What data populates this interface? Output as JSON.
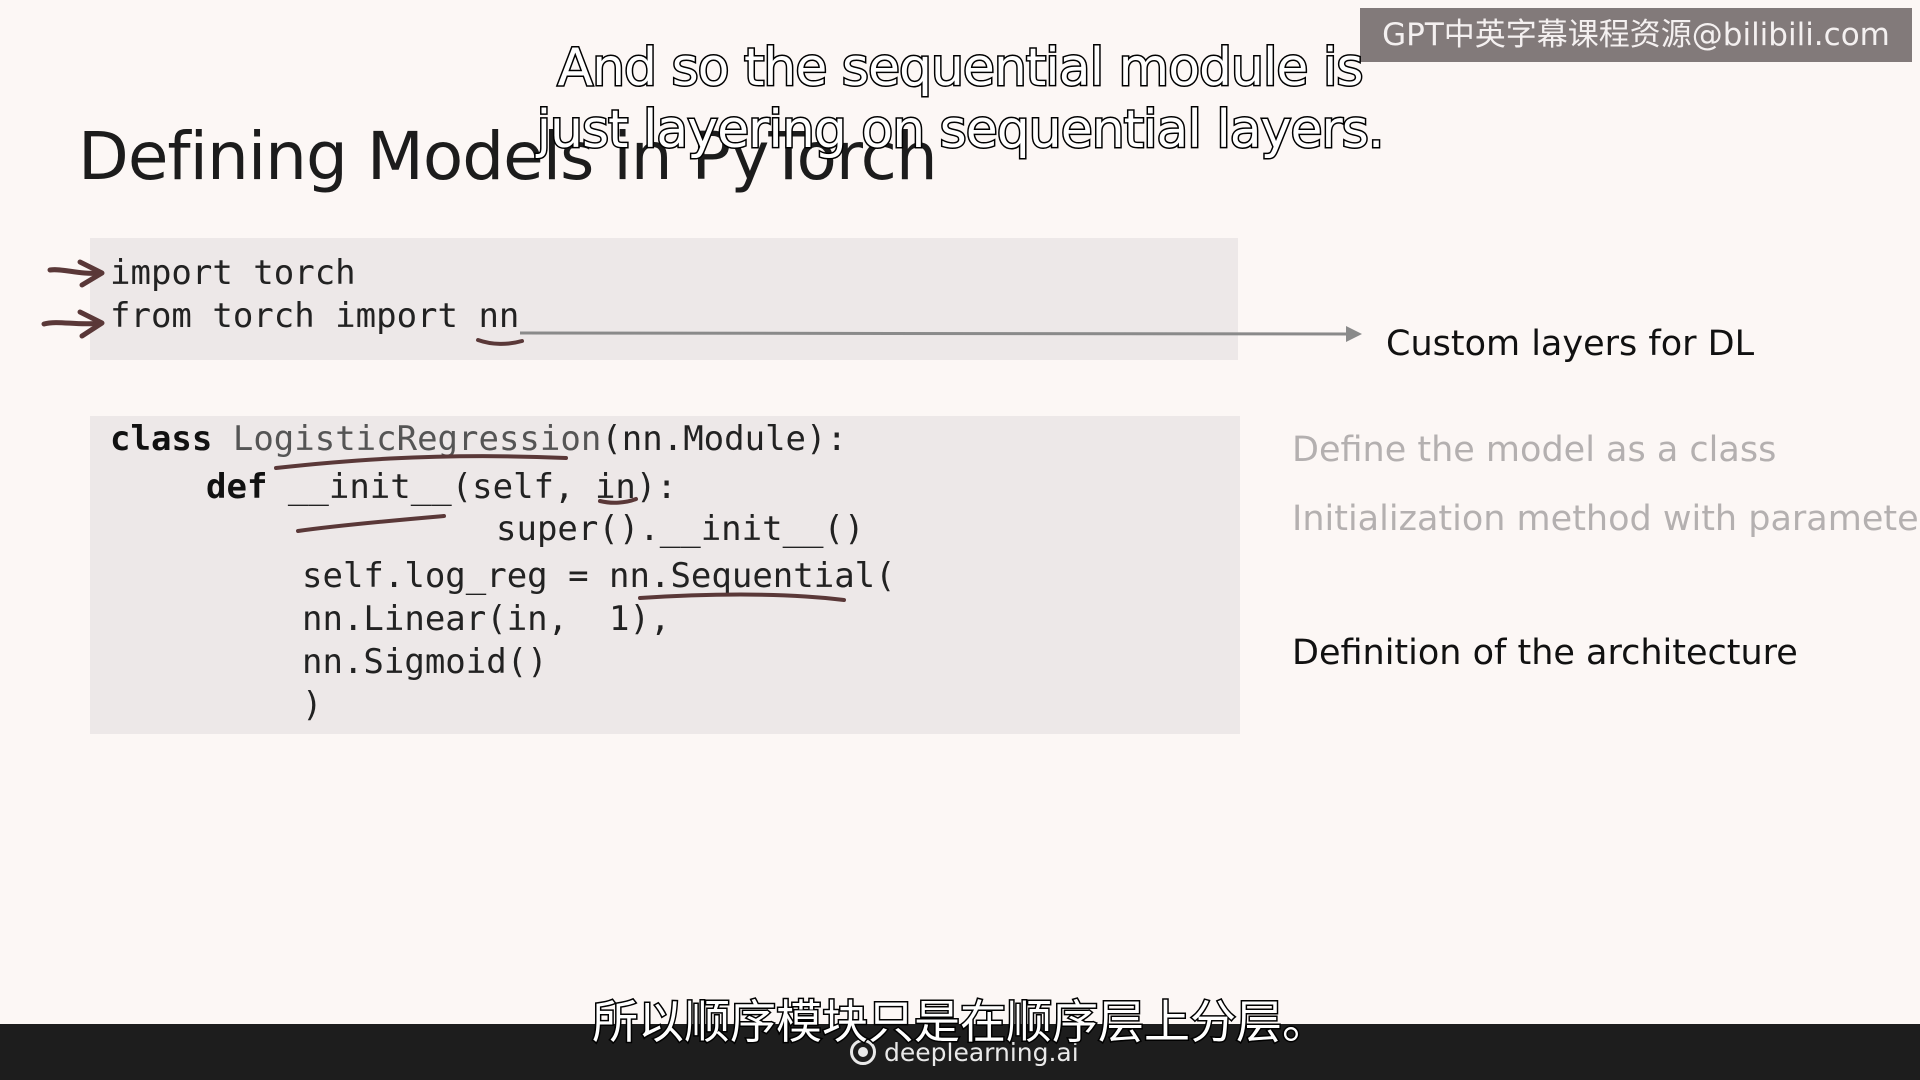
{
  "slide": {
    "title": "Defining Models in PyTorch"
  },
  "code_imports": [
    {
      "kw": "",
      "text": "import torch"
    },
    {
      "kw": "",
      "text": "from torch import nn"
    }
  ],
  "code_class": {
    "line1_kw": "class",
    "line1_name": "LogisticRegression",
    "line1_rest": "(nn.Module):",
    "line2_kw": "def",
    "line2_rest": "__init__(self, in):",
    "line3": "super().__init__()",
    "line4": "self.log_reg = nn.Sequential(",
    "line5": "nn.Linear(in,  1),",
    "line6": "nn.Sigmoid()",
    "line7": ")"
  },
  "annotations": {
    "custom_layers": "Custom layers for DL",
    "define_class": "Define the model as a class",
    "init_method": "Initialization method with parameters",
    "architecture": "Definition of the architecture"
  },
  "subtitles": {
    "en_line1": "And so the sequential module is",
    "en_line2": "just layering on sequential layers.",
    "zh": "所以顺序模块只是在顺序层上分层。"
  },
  "watermark": {
    "text": "GPT中英字幕课程资源@bilibili.com"
  },
  "footer": {
    "brand": "deeplearning.ai"
  },
  "colors": {
    "background": "#fcf7f5",
    "code_box": "#ede8e8",
    "ink": "#5a3838",
    "faded_text": "#b4b0b0",
    "bottom_bar": "#1d1d1d"
  }
}
